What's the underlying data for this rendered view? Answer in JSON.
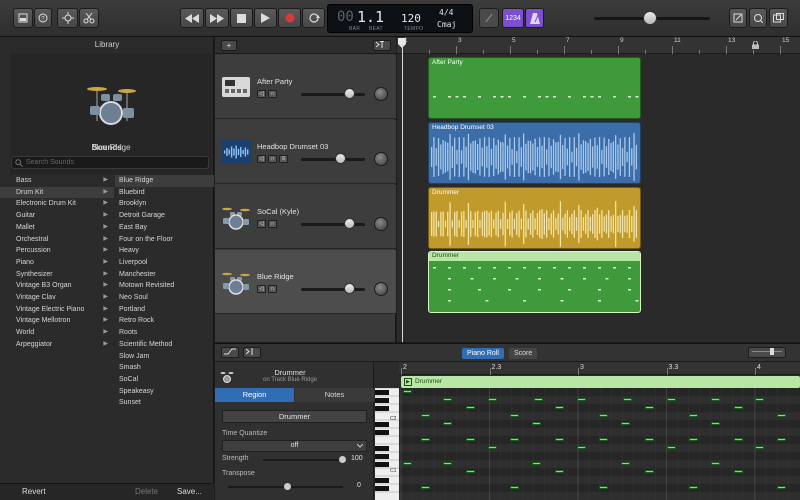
{
  "lcd": {
    "bar": "00",
    "beat_value": "1.1",
    "bar_label": "BAR",
    "beat_label": "BEAT",
    "tempo": "120",
    "tempo_label": "TEMPO",
    "time_signature": "4/4",
    "key": "Cmaj"
  },
  "toolbar": {
    "count_in_label": "1234"
  },
  "library": {
    "title": "Library",
    "patch_name": "Blue Ridge",
    "sounds_title": "Sounds",
    "search_placeholder": "Search Sounds",
    "categories": [
      "Bass",
      "Drum Kit",
      "Electronic Drum Kit",
      "Guitar",
      "Mallet",
      "Orchestral",
      "Percussion",
      "Piano",
      "Synthesizer",
      "Vintage B3 Organ",
      "Vintage Clav",
      "Vintage Electric Piano",
      "Vintage Mellotron",
      "World",
      "Arpeggiator"
    ],
    "selected_category": 1,
    "patches": [
      "Blue Ridge",
      "Bluebird",
      "Brooklyn",
      "Detroit Garage",
      "East Bay",
      "Four on the Floor",
      "Heavy",
      "Liverpool",
      "Manchester",
      "Motown Revisited",
      "Neo Soul",
      "Portland",
      "Retro Rock",
      "Roots",
      "Scientific Method",
      "Slow Jam",
      "Smash",
      "SoCal",
      "Speakeasy",
      "Sunset"
    ],
    "selected_patch": 0,
    "revert_label": "Revert",
    "delete_label": "Delete",
    "save_label": "Save..."
  },
  "tracks": [
    {
      "name": "After Party",
      "icon": "drum-machine-icon",
      "volume": 0.75
    },
    {
      "name": "Headbop Drumset 03",
      "icon": "waveform-icon",
      "volume": 0.62
    },
    {
      "name": "SoCal (Kyle)",
      "icon": "drum-kit-icon",
      "volume": 0.75
    },
    {
      "name": "Blue Ridge",
      "icon": "drum-kit-icon",
      "volume": 0.75
    }
  ],
  "ruler": {
    "ticks": [
      "1",
      "3",
      "5",
      "7",
      "9",
      "11",
      "13",
      "15"
    ]
  },
  "regions": [
    {
      "title": "After Party",
      "color": "#3e9a3a",
      "kind": "midi"
    },
    {
      "title": "Headbop Drumset 03",
      "color": "#3b6ea8",
      "kind": "audio"
    },
    {
      "title": "Drummer",
      "color": "#c09a2a",
      "kind": "drummer"
    },
    {
      "title": "Drummer",
      "color": "#3e9a3a",
      "kind": "midi-selected"
    }
  ],
  "editor": {
    "tab_piano_roll": "Piano Roll",
    "tab_score": "Score",
    "region_name": "Drummer",
    "region_subtitle": "on Track Blue Ridge",
    "tab_region": "Region",
    "tab_notes": "Notes",
    "region_field": "Drummer",
    "time_quantize_label": "Time Quantize",
    "time_quantize_value": "off",
    "strength_label": "Strength",
    "strength_value": "100",
    "transpose_label": "Transpose",
    "transpose_value": "0",
    "ruler_ticks": [
      "2",
      "2.3",
      "3",
      "3.3",
      "4"
    ],
    "roll_region_title": "Drummer",
    "key_labels": [
      "C2",
      "C1"
    ]
  },
  "colors": {
    "accent_blue": "#2f6db5",
    "record_red": "#d83a3a",
    "count_in_purple": "#7b4fcf"
  }
}
